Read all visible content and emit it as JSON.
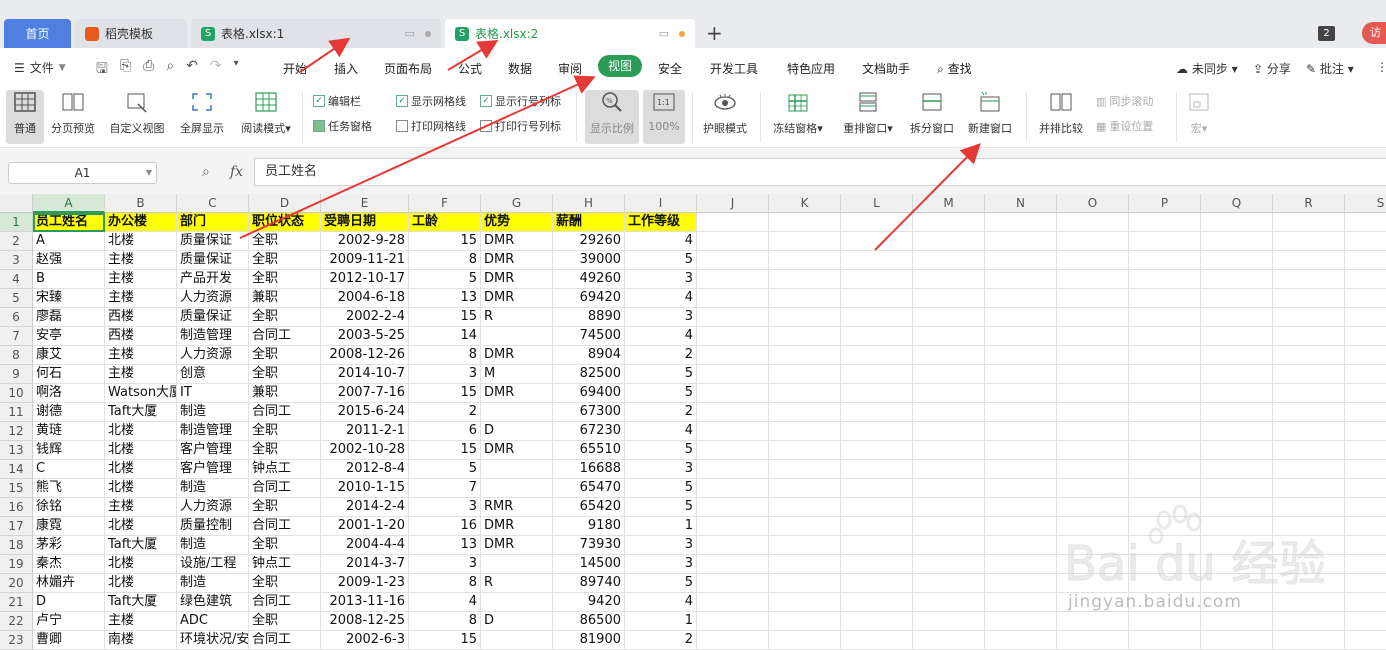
{
  "tabs": {
    "home": "首页",
    "daoke": "稻壳模板",
    "file1": "表格.xlsx:1",
    "file2": "表格.xlsx:2",
    "add": "+",
    "window_count": "2",
    "visit": "访"
  },
  "menu": {
    "file": "文件",
    "items": [
      "开始",
      "插入",
      "页面布局",
      "公式",
      "数据",
      "审阅",
      "视图",
      "安全",
      "开发工具",
      "特色应用",
      "文档助手"
    ],
    "search": "查找",
    "sync": "未同步",
    "share": "分享",
    "comment": "批注"
  },
  "ribbon": {
    "normal": "普通",
    "page_preview": "分页预览",
    "custom_view": "自定义视图",
    "fullscreen": "全屏显示",
    "reading_mode": "阅读模式",
    "edit_bar": "编辑栏",
    "task_pane": "任务窗格",
    "show_gridlines": "显示网格线",
    "print_gridlines": "打印网格线",
    "show_headings": "显示行号列标",
    "print_headings": "打印行号列标",
    "zoom_ratio": "显示比例",
    "zoom_100": "100%",
    "eye_mode": "护眼模式",
    "freeze": "冻结窗格",
    "arrange": "重排窗口",
    "split": "拆分窗口",
    "new_window": "新建窗口",
    "side_by_side": "并排比较",
    "sync_scroll": "同步滚动",
    "reset_position": "重设位置",
    "macro": "宏"
  },
  "formula": {
    "cell_ref": "A1",
    "fx": "fx",
    "value": "员工姓名"
  },
  "columns": [
    "A",
    "B",
    "C",
    "D",
    "E",
    "F",
    "G",
    "H",
    "I",
    "J",
    "K",
    "L",
    "M",
    "N",
    "O",
    "P",
    "Q",
    "R",
    "S"
  ],
  "table": {
    "headers": [
      "员工姓名",
      "办公楼",
      "部门",
      "职位状态",
      "受聘日期",
      "工龄",
      "优势",
      "薪酬",
      "工作等级"
    ],
    "rows": [
      [
        "A",
        "北楼",
        "质量保证",
        "全职",
        "2002-9-28",
        "15",
        "DMR",
        "29260",
        "4"
      ],
      [
        "赵强",
        "主楼",
        "质量保证",
        "全职",
        "2009-11-21",
        "8",
        "DMR",
        "39000",
        "5"
      ],
      [
        "B",
        "主楼",
        "产品开发",
        "全职",
        "2012-10-17",
        "5",
        "DMR",
        "49260",
        "3"
      ],
      [
        "宋臻",
        "主楼",
        "人力资源",
        "兼职",
        "2004-6-18",
        "13",
        "DMR",
        "69420",
        "4"
      ],
      [
        "廖磊",
        "西楼",
        "质量保证",
        "全职",
        "2002-2-4",
        "15",
        "R",
        "8890",
        "3"
      ],
      [
        "安亭",
        "西楼",
        "制造管理",
        "合同工",
        "2003-5-25",
        "14",
        "",
        "74500",
        "4"
      ],
      [
        "康艾",
        "主楼",
        "人力资源",
        "全职",
        "2008-12-26",
        "8",
        "DMR",
        "8904",
        "2"
      ],
      [
        "何石",
        "主楼",
        "创意",
        "全职",
        "2014-10-7",
        "3",
        "M",
        "82500",
        "5"
      ],
      [
        "啊洛",
        "Watson大厦",
        "IT",
        "兼职",
        "2007-7-16",
        "15",
        "DMR",
        "69400",
        "5"
      ],
      [
        "谢德",
        "Taft大厦",
        "制造",
        "合同工",
        "2015-6-24",
        "2",
        "",
        "67300",
        "2"
      ],
      [
        "黄琏",
        "北楼",
        "制造管理",
        "全职",
        "2011-2-1",
        "6",
        "D",
        "67230",
        "4"
      ],
      [
        "钱辉",
        "北楼",
        "客户管理",
        "全职",
        "2002-10-28",
        "15",
        "DMR",
        "65510",
        "5"
      ],
      [
        "C",
        "北楼",
        "客户管理",
        "钟点工",
        "2012-8-4",
        "5",
        "",
        "16688",
        "3"
      ],
      [
        "熊飞",
        "北楼",
        "制造",
        "合同工",
        "2010-1-15",
        "7",
        "",
        "65470",
        "5"
      ],
      [
        "徐铭",
        "主楼",
        "人力资源",
        "全职",
        "2014-2-4",
        "3",
        "RMR",
        "65420",
        "5"
      ],
      [
        "康霓",
        "北楼",
        "质量控制",
        "合同工",
        "2001-1-20",
        "16",
        "DMR",
        "9180",
        "1"
      ],
      [
        "茅彩",
        "Taft大厦",
        "制造",
        "全职",
        "2004-4-4",
        "13",
        "DMR",
        "73930",
        "3"
      ],
      [
        "秦杰",
        "北楼",
        "设施/工程",
        "钟点工",
        "2014-3-7",
        "3",
        "",
        "14500",
        "3"
      ],
      [
        "林媚卉",
        "北楼",
        "制造",
        "全职",
        "2009-1-23",
        "8",
        "R",
        "89740",
        "5"
      ],
      [
        "D",
        "Taft大厦",
        "绿色建筑",
        "合同工",
        "2013-11-16",
        "4",
        "",
        "9420",
        "4"
      ],
      [
        "卢宁",
        "主楼",
        "ADC",
        "全职",
        "2008-12-25",
        "8",
        "D",
        "86500",
        "1"
      ],
      [
        "曹卿",
        "南楼",
        "环境状况/安全",
        "合同工",
        "2002-6-3",
        "15",
        "",
        "81900",
        "2"
      ]
    ]
  },
  "watermark": {
    "logo": "Bai du 经验",
    "url": "jingyan.baidu.com"
  },
  "colors": {
    "accent_green": "#2a9c55",
    "header_fill": "#ffff00",
    "home_tab": "#4f7fe0",
    "arrow_red": "#e53935"
  }
}
